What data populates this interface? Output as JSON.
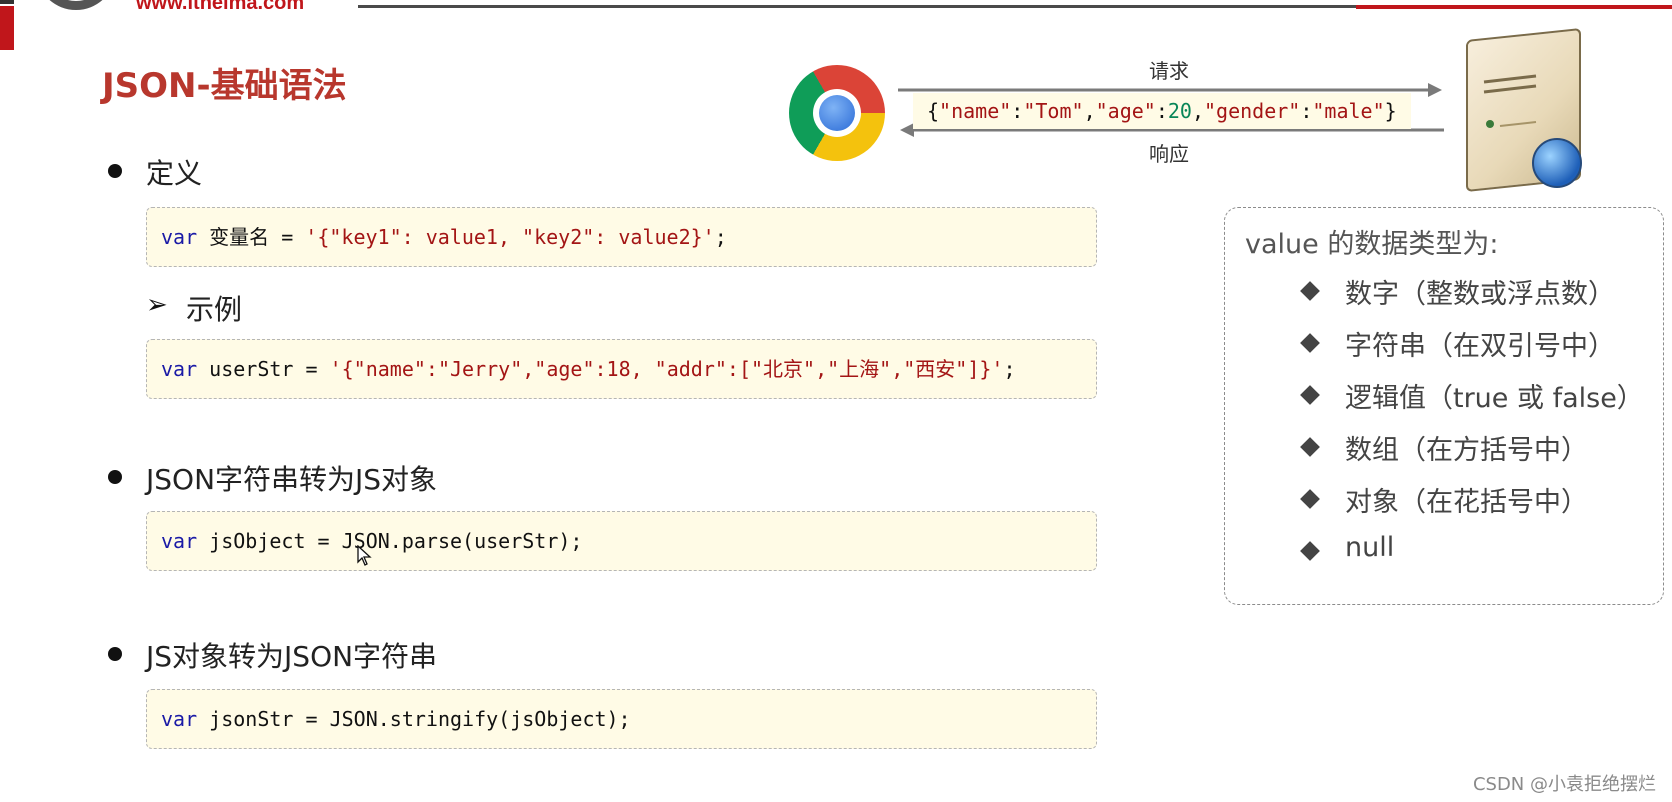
{
  "header": {
    "logo_text": "www.itheima.com"
  },
  "slide": {
    "title": "JSON-基础语法",
    "sections": [
      {
        "heading": "定义"
      },
      {
        "heading": "示例"
      },
      {
        "heading": "JSON字符串转为JS对象"
      },
      {
        "heading": "JS对象转为JSON字符串"
      }
    ],
    "code": [
      {
        "t1": "var",
        "t2": " 变量名 = ",
        "t3": "'{\"key1\": value1, \"key2\": value2}'",
        "t4": ";"
      },
      {
        "t1": "var",
        "t2": " userStr = ",
        "t3": "'{\"name\":\"Jerry\",\"age\":18, \"addr\":[\"北京\",\"上海\",\"西安\"]}'",
        "t4": ";"
      },
      {
        "t1": "var",
        "t2": " jsObject = JSON.parse(userStr);"
      },
      {
        "t1": "var",
        "t2": " jsonStr = JSON.stringify(jsObject);"
      }
    ],
    "diagram": {
      "request_label": "请求",
      "response_label": "响应",
      "json_parts": [
        "{",
        "\"name\"",
        ":",
        "\"Tom\"",
        ",",
        "\"age\"",
        ":",
        "20",
        ",",
        "\"gender\"",
        ":",
        "\"male\"",
        "}"
      ]
    },
    "value_types": {
      "title": "value 的数据类型为:",
      "items": [
        "数字（整数或浮点数）",
        "字符串（在双引号中）",
        "逻辑值（true 或 false）",
        "数组（在方括号中）",
        "对象（在花括号中）",
        "null"
      ]
    }
  },
  "watermark": "CSDN @小袁拒绝摆烂",
  "colors": {
    "accent": "#b8372d",
    "code_bg": "#fffbe6",
    "keyword": "#1a1aa6",
    "string": "#a31515",
    "number": "#098658"
  }
}
